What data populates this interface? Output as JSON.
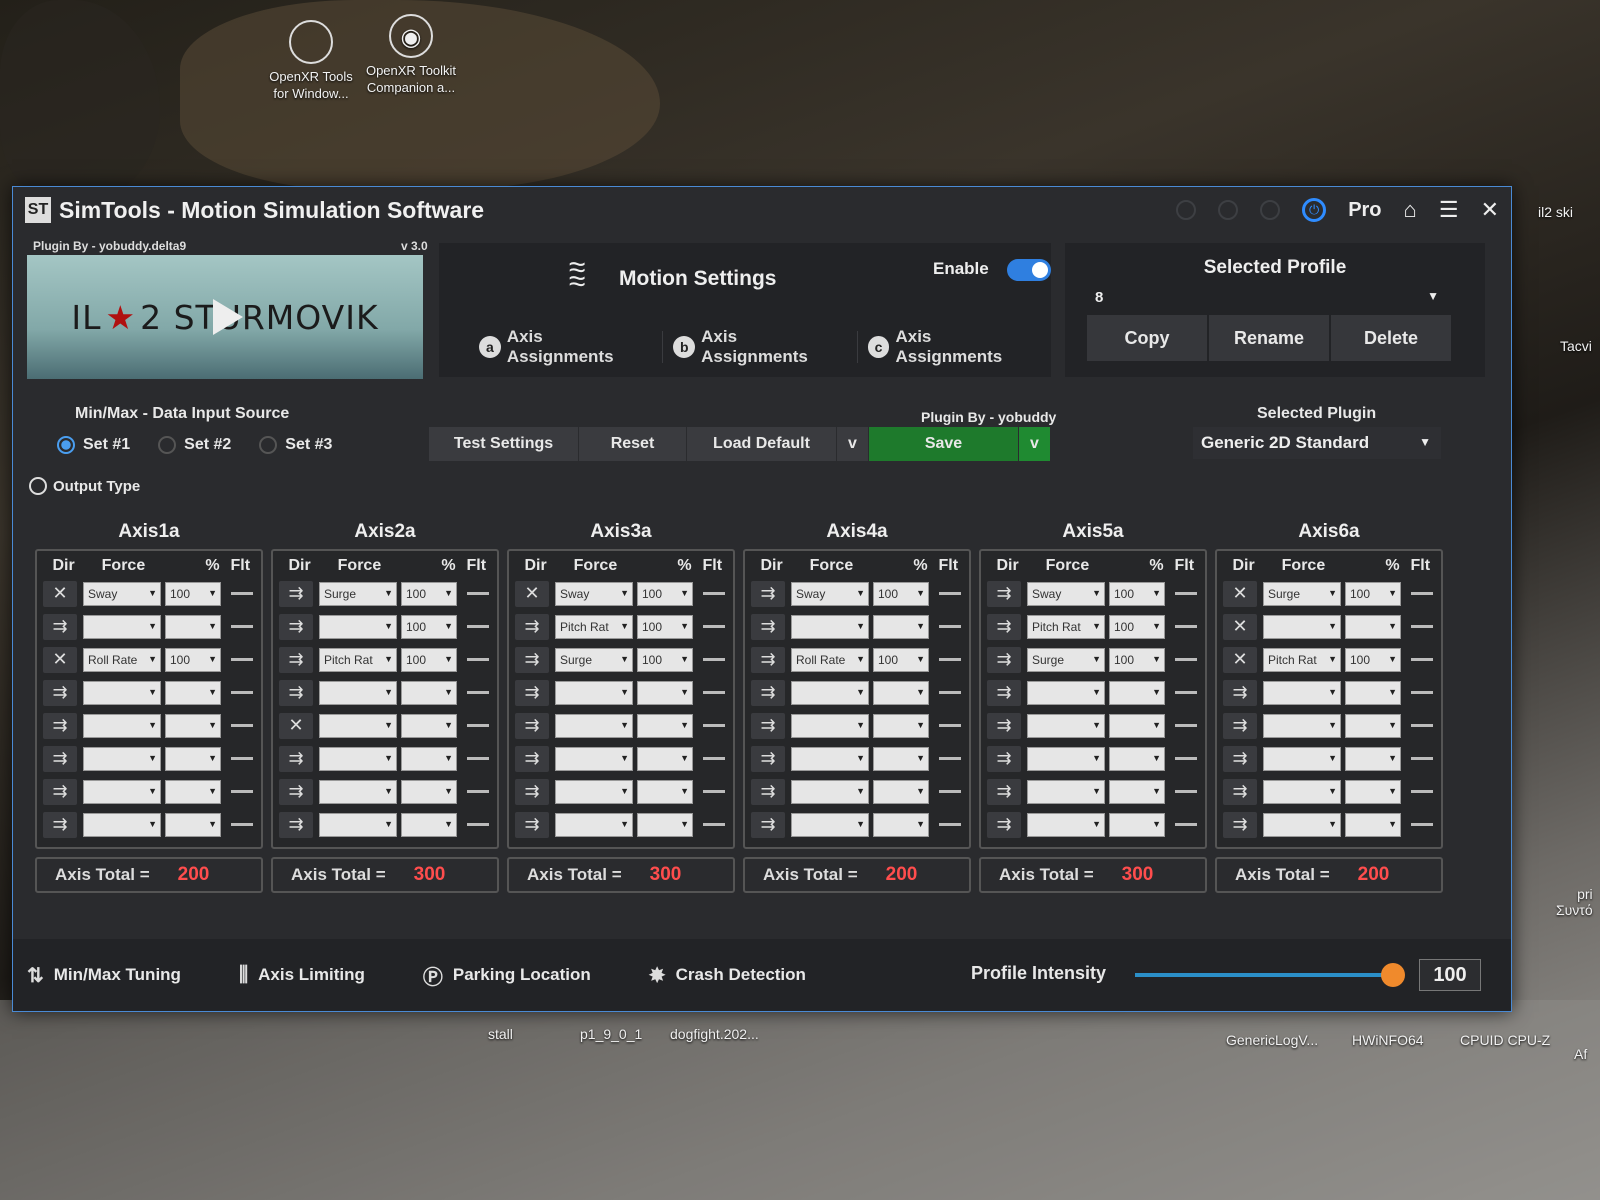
{
  "desktop": {
    "icons_top": [
      {
        "label": "OpenXR Tools\nfor Window..."
      },
      {
        "label": "OpenXR Toolkit\nCompanion a..."
      }
    ],
    "right_labels": [
      "il2 ski",
      "Tacvi",
      "pri\nΣυντό",
      "Af"
    ],
    "bottom_labels": [
      "stall",
      "p1_9_0_1",
      "dogfight.202...",
      "GenericLogV...",
      "HWiNFO64",
      "CPUID CPU-Z"
    ]
  },
  "window": {
    "title": "SimTools - Motion Simulation Software",
    "pro_label": "Pro",
    "plugin_by_top": "Plugin By - yobuddy.delta9",
    "version": "v 3.0",
    "game_banner": {
      "left": "IL",
      "star": "★",
      "right": "2 STURMOVIK"
    }
  },
  "motion": {
    "title": "Motion Settings",
    "enable_label": "Enable",
    "enabled": true,
    "tabs": [
      {
        "badge": "a",
        "label": "Axis Assignments"
      },
      {
        "badge": "b",
        "label": "Axis Assignments"
      },
      {
        "badge": "c",
        "label": "Axis Assignments"
      }
    ]
  },
  "profile": {
    "label": "Selected Profile",
    "value": "8",
    "buttons": [
      "Copy",
      "Rename",
      "Delete"
    ]
  },
  "input_source": {
    "label": "Min/Max - Data Input Source",
    "sets": [
      "Set #1",
      "Set #2",
      "Set #3"
    ],
    "selected": "Set #1",
    "output_type": "Output Type"
  },
  "controls": {
    "plugin_by": "Plugin By - yobuddy",
    "test": "Test Settings",
    "reset": "Reset",
    "load_default": "Load Default",
    "load_arrow": "v",
    "save": "Save",
    "save_arrow": "v",
    "selected_plugin_label": "Selected Plugin",
    "selected_plugin": "Generic 2D Standard"
  },
  "axis_header": {
    "dir": "Dir",
    "force": "Force",
    "pct": "%",
    "flt": "Flt"
  },
  "axis_total_label": "Axis Total =",
  "axes": [
    {
      "name": "Axis1a",
      "total": "200",
      "rows": [
        {
          "dir": "mix",
          "force": "Sway",
          "pct": "100"
        },
        {
          "dir": "fwd",
          "force": "",
          "pct": ""
        },
        {
          "dir": "mix",
          "force": "Roll Rate",
          "pct": "100"
        },
        {
          "dir": "fwd",
          "force": "",
          "pct": ""
        },
        {
          "dir": "fwd",
          "force": "",
          "pct": ""
        },
        {
          "dir": "fwd",
          "force": "",
          "pct": ""
        },
        {
          "dir": "fwd",
          "force": "",
          "pct": ""
        },
        {
          "dir": "fwd",
          "force": "",
          "pct": ""
        }
      ]
    },
    {
      "name": "Axis2a",
      "total": "300",
      "rows": [
        {
          "dir": "fwd",
          "force": "Surge",
          "pct": "100"
        },
        {
          "dir": "fwd",
          "force": "",
          "pct": "100"
        },
        {
          "dir": "fwd",
          "force": "Pitch Rat",
          "pct": "100"
        },
        {
          "dir": "fwd",
          "force": "",
          "pct": ""
        },
        {
          "dir": "mix",
          "force": "",
          "pct": ""
        },
        {
          "dir": "fwd",
          "force": "",
          "pct": ""
        },
        {
          "dir": "fwd",
          "force": "",
          "pct": ""
        },
        {
          "dir": "fwd",
          "force": "",
          "pct": ""
        }
      ]
    },
    {
      "name": "Axis3a",
      "total": "300",
      "rows": [
        {
          "dir": "mix",
          "force": "Sway",
          "pct": "100"
        },
        {
          "dir": "fwd",
          "force": "Pitch Rat",
          "pct": "100"
        },
        {
          "dir": "fwd",
          "force": "Surge",
          "pct": "100"
        },
        {
          "dir": "fwd",
          "force": "",
          "pct": ""
        },
        {
          "dir": "fwd",
          "force": "",
          "pct": ""
        },
        {
          "dir": "fwd",
          "force": "",
          "pct": ""
        },
        {
          "dir": "fwd",
          "force": "",
          "pct": ""
        },
        {
          "dir": "fwd",
          "force": "",
          "pct": ""
        }
      ]
    },
    {
      "name": "Axis4a",
      "total": "200",
      "rows": [
        {
          "dir": "fwd",
          "force": "Sway",
          "pct": "100"
        },
        {
          "dir": "fwd",
          "force": "",
          "pct": ""
        },
        {
          "dir": "fwd",
          "force": "Roll Rate",
          "pct": "100"
        },
        {
          "dir": "fwd",
          "force": "",
          "pct": ""
        },
        {
          "dir": "fwd",
          "force": "",
          "pct": ""
        },
        {
          "dir": "fwd",
          "force": "",
          "pct": ""
        },
        {
          "dir": "fwd",
          "force": "",
          "pct": ""
        },
        {
          "dir": "fwd",
          "force": "",
          "pct": ""
        }
      ]
    },
    {
      "name": "Axis5a",
      "total": "300",
      "rows": [
        {
          "dir": "fwd",
          "force": "Sway",
          "pct": "100"
        },
        {
          "dir": "fwd",
          "force": "Pitch Rat",
          "pct": "100"
        },
        {
          "dir": "fwd",
          "force": "Surge",
          "pct": "100"
        },
        {
          "dir": "fwd",
          "force": "",
          "pct": ""
        },
        {
          "dir": "fwd",
          "force": "",
          "pct": ""
        },
        {
          "dir": "fwd",
          "force": "",
          "pct": ""
        },
        {
          "dir": "fwd",
          "force": "",
          "pct": ""
        },
        {
          "dir": "fwd",
          "force": "",
          "pct": ""
        }
      ]
    },
    {
      "name": "Axis6a",
      "total": "200",
      "rows": [
        {
          "dir": "mix",
          "force": "Surge",
          "pct": "100"
        },
        {
          "dir": "mix",
          "force": "",
          "pct": ""
        },
        {
          "dir": "mix",
          "force": "Pitch Rat",
          "pct": "100"
        },
        {
          "dir": "fwd",
          "force": "",
          "pct": ""
        },
        {
          "dir": "fwd",
          "force": "",
          "pct": ""
        },
        {
          "dir": "fwd",
          "force": "",
          "pct": ""
        },
        {
          "dir": "fwd",
          "force": "",
          "pct": ""
        },
        {
          "dir": "fwd",
          "force": "",
          "pct": ""
        }
      ]
    }
  ],
  "bottom_bar": {
    "items": [
      "Min/Max Tuning",
      "Axis Limiting",
      "Parking Location",
      "Crash Detection"
    ],
    "intensity_label": "Profile Intensity",
    "intensity_value": "100",
    "intensity_fraction": 1.0
  },
  "colors": {
    "accent_blue": "#2f7fe0",
    "save_green": "#1e7a2c",
    "total_red": "#ff4d4d",
    "slider_knob": "#f08a2c"
  }
}
